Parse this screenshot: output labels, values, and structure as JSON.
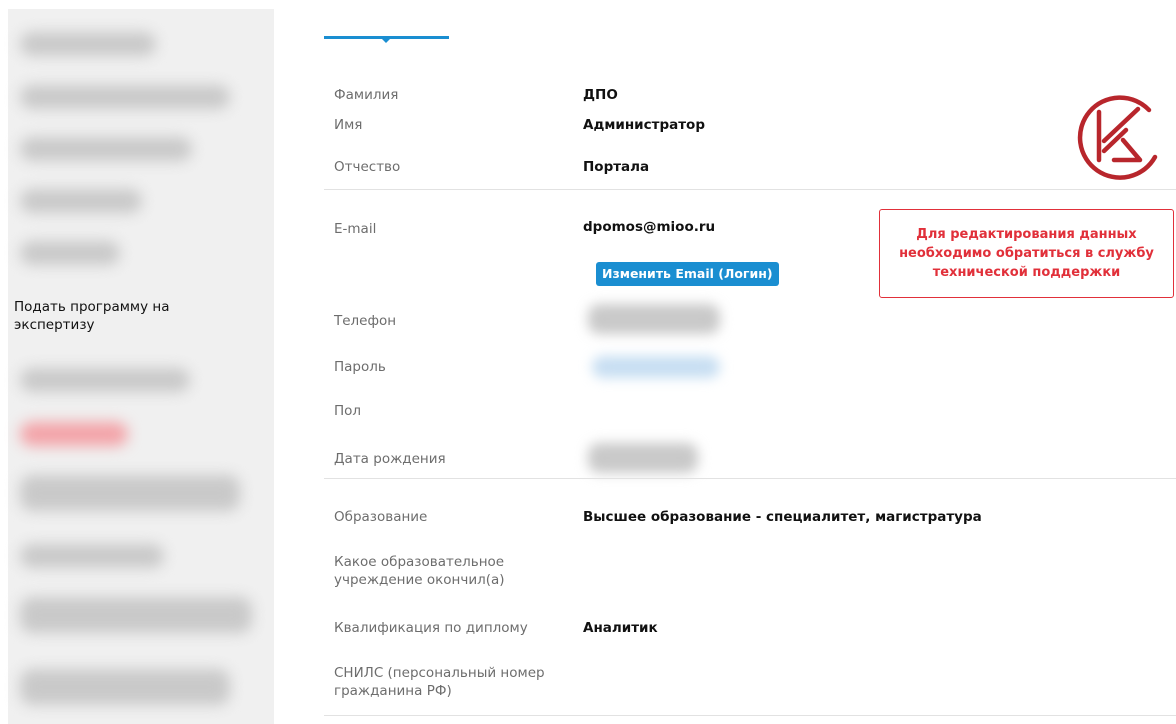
{
  "colors": {
    "accent": "#1a8ed1",
    "alert": "#e1303a",
    "logo": "#b8262c"
  },
  "sidebar": {
    "submit_link": "Подать программу на экспертизу"
  },
  "profile": {
    "last_name": {
      "label": "Фамилия",
      "value": "ДПО"
    },
    "first_name": {
      "label": "Имя",
      "value": "Администратор"
    },
    "patronymic": {
      "label": "Отчество",
      "value": "Портала"
    },
    "email": {
      "label": "E-mail",
      "value": "dpomos@mioo.ru",
      "change_button": "Изменить Email (Логин)"
    },
    "phone": {
      "label": "Телефон"
    },
    "password": {
      "label": "Пароль"
    },
    "gender": {
      "label": "Пол"
    },
    "birth_date": {
      "label": "Дата рождения"
    },
    "education": {
      "label": "Образование",
      "value": "Высшее образование - специалитет, магистратура"
    },
    "institution": {
      "label": "Какое образовательное учреждение окончил(а)"
    },
    "qualification": {
      "label": "Квалификация по диплому",
      "value": "Аналитик"
    },
    "snils": {
      "label": "СНИЛС (персональный номер гражданина РФ)"
    }
  },
  "notice": {
    "text": "Для редактирования данных необходимо обратиться в службу технической поддержки"
  },
  "logo": {
    "icon": "k-monogram-logo-icon"
  }
}
